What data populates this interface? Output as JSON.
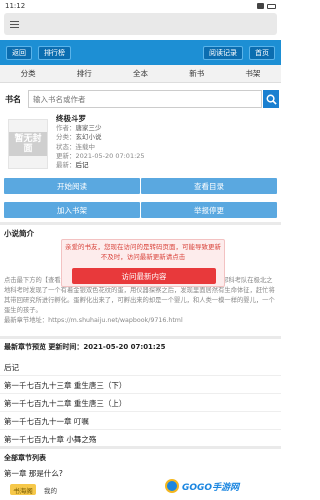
{
  "statusbar": {
    "time": "11:12"
  },
  "toolbar": {
    "back_label": "返回",
    "ranking_label": "排行榜",
    "history_label": "阅读记录",
    "home_label": "首页"
  },
  "nav": {
    "items": [
      {
        "label": "分类"
      },
      {
        "label": "排行"
      },
      {
        "label": "全本"
      },
      {
        "label": "新书"
      },
      {
        "label": "书架"
      }
    ]
  },
  "search": {
    "label": "书名",
    "placeholder": "输入书名或作者"
  },
  "book": {
    "cover_text": "暂无封面",
    "title": "终极斗罗",
    "author_label": "作者：",
    "author": "唐家三少",
    "category_label": "分类：",
    "category": "玄幻小说",
    "status_label": "状态：",
    "status": "连载中",
    "updated_label": "更新：",
    "updated": "2021-05-20 07:01:25",
    "latest_label": "最新：",
    "latest": "后记"
  },
  "actions": {
    "start_reading": "开始阅读",
    "view_catalog": "查看目录",
    "add_shelf": "加入书架",
    "report": "举报停更"
  },
  "intro": {
    "heading": "小说简介",
    "text": "点击最下方的【查看所有章节】看最新章节！！！ 一万年后，冰化了。 斗罗联邦科考队在极北之地科考时发现了一个有着金银双色花纹的蛋，用仪器探察之后，发现里面居然有生命体征，赶忙将其带回研究所进行孵化。蛋孵化出来了，可孵出来的却是一个婴儿，和人类一模一样的婴儿，一个蛋生的孩子。",
    "url_text": "最新章节地址：https://m.shuhaiju.net/wapbook/9716.html"
  },
  "popup": {
    "message": "亲爱的书友，您现在访问的是转码页面，可能导致更新不及时，访问最新更新请点击",
    "button": "访问最新内容"
  },
  "latest_section": {
    "heading": "最新章节预览 更新时间：2021-05-20 07:01:25"
  },
  "latest_chapters": [
    {
      "title": "后记"
    },
    {
      "title": "第一千七百九十三章 重生唐三（下）"
    },
    {
      "title": "第一千七百九十二章 重生唐三（上）"
    },
    {
      "title": "第一千七百九十一章 叮嘱"
    },
    {
      "title": "第一千七百九十章 小舞之殇"
    }
  ],
  "all_chapters": {
    "heading": "全部章节列表",
    "first": "第一章 那是什么?",
    "tag_label": "书海阁",
    "tag2_label": "我的"
  },
  "watermark": {
    "text": "GOGO手游网"
  },
  "colors": {
    "accent": "#1d8fd4",
    "button": "#5aa8e0",
    "popup_button": "#e8393b"
  }
}
